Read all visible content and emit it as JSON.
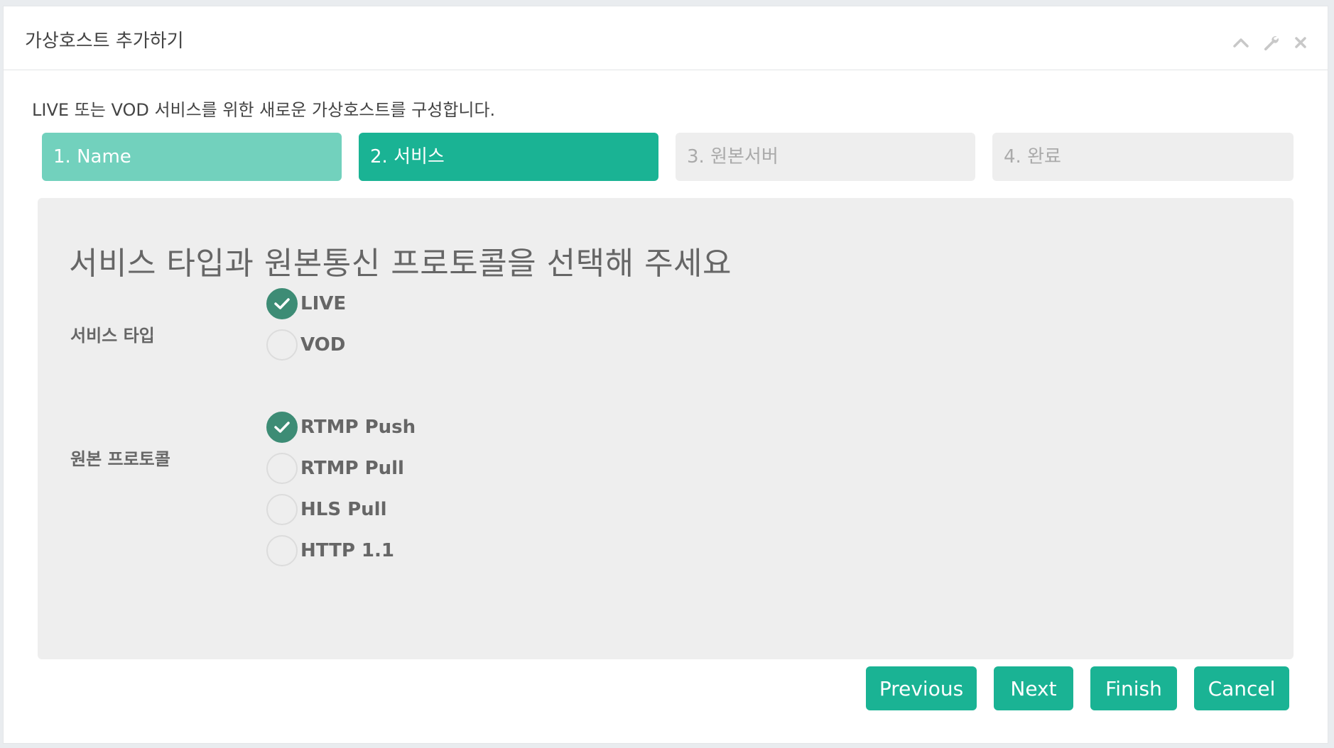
{
  "window": {
    "title": "가상호스트 추가하기",
    "tools": [
      "chevron-up-icon",
      "wrench-icon",
      "close-icon"
    ]
  },
  "intro_text": "LIVE 또는 VOD 서비스를 위한 새로운 가상호스트를 구성합니다.",
  "steps": [
    {
      "label": "1. Name",
      "state": "done"
    },
    {
      "label": "2. 서비스",
      "state": "active"
    },
    {
      "label": "3. 원본서버",
      "state": "pending"
    },
    {
      "label": "4. 완료",
      "state": "pending"
    }
  ],
  "section_title": "서비스 타입과 원본통신 프로토콜을 선택해 주세요",
  "service_type": {
    "label": "서비스 타입",
    "options": [
      {
        "label": "LIVE",
        "checked": true
      },
      {
        "label": "VOD",
        "checked": false
      }
    ]
  },
  "origin_protocol": {
    "label": "원본 프로토콜",
    "options": [
      {
        "label": "RTMP Push",
        "checked": true
      },
      {
        "label": "RTMP Pull",
        "checked": false
      },
      {
        "label": "HLS Pull",
        "checked": false
      },
      {
        "label": "HTTP 1.1",
        "checked": false
      }
    ]
  },
  "buttons": {
    "previous": "Previous",
    "next": "Next",
    "finish": "Finish",
    "cancel": "Cancel"
  },
  "colors": {
    "accent": "#1ab394",
    "accent_light": "#72d1bd",
    "checked": "#3d8c75",
    "step_pending": "#eeeeee"
  }
}
